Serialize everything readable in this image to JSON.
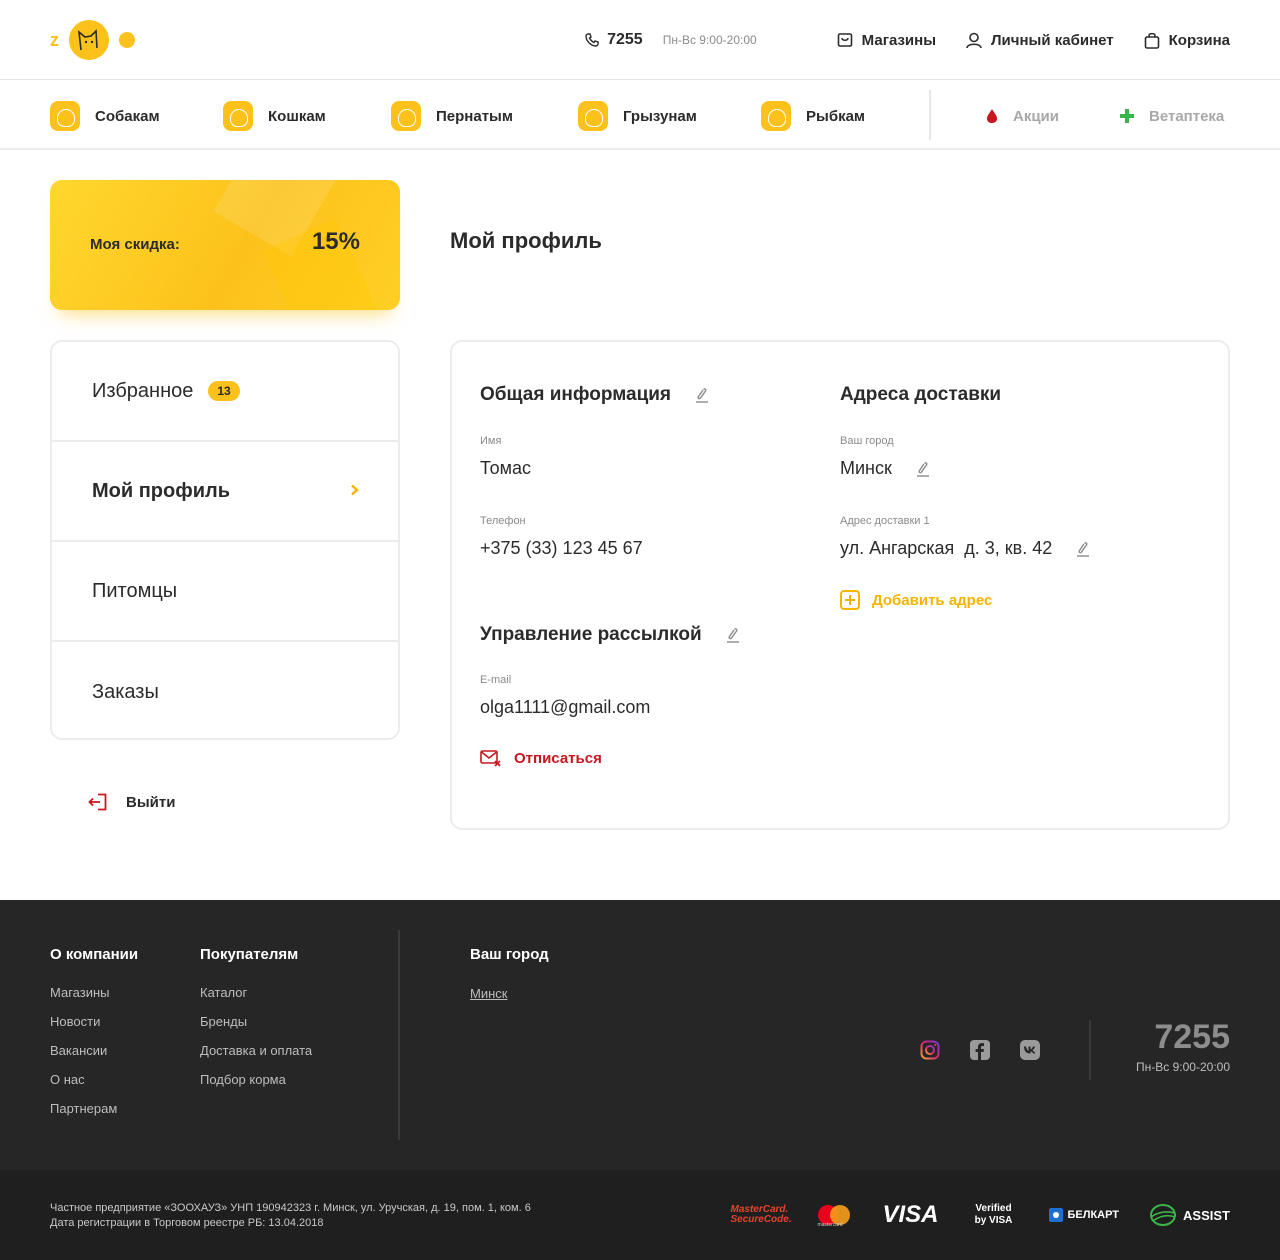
{
  "header": {
    "phone": "7255",
    "hours": "Пн-Вс 9:00-20:00",
    "links": [
      "Магазины",
      "Личный кабинет",
      "Корзина"
    ]
  },
  "nav": {
    "categories": [
      "Собакам",
      "Кошкам",
      "Пернатым",
      "Грызунам",
      "Рыбкам"
    ],
    "extra": [
      "Акции",
      "Ветаптека"
    ]
  },
  "discount": {
    "label": "Моя скидка:",
    "value": "15%"
  },
  "page_title": "Мой профиль",
  "side_menu": {
    "items": [
      {
        "label": "Избранное",
        "badge": "13"
      },
      {
        "label": "Мой профиль"
      },
      {
        "label": "Питомцы"
      },
      {
        "label": "Заказы"
      }
    ],
    "logout": "Выйти"
  },
  "profile": {
    "general": {
      "title": "Общая информация",
      "name_label": "Имя",
      "name": "Томас",
      "phone_label": "Телефон",
      "phone": "+375 (33) 123 45 67"
    },
    "mailing": {
      "title": "Управление рассылкой",
      "email_label": "E-mail",
      "email": "olga1111@gmail.com",
      "unsubscribe": "Отписаться"
    },
    "delivery": {
      "title": "Адреса доставки",
      "city_label": "Ваш город",
      "city": "Минск",
      "address_label": "Адрес доставки 1",
      "address": "ул. Ангарская  д. 3, кв. 42",
      "add_address": "Добавить адрес"
    }
  },
  "footer": {
    "company": {
      "title": "О компании",
      "links": [
        "Магазины",
        "Новости",
        "Вакансии",
        "О нас",
        "Партнерам"
      ]
    },
    "buyers": {
      "title": "Покупателям",
      "links": [
        "Каталог",
        "Бренды",
        "Доставка и оплата",
        "Подбор корма"
      ]
    },
    "city": {
      "title": "Ваш город",
      "value": "Минск"
    },
    "phone": "7255",
    "hours": "Пн-Вс 9:00-20:00",
    "legal_1": "Частное предприятие «ЗООХАУЗ» УНП 190942323 г. Минск, ул. Уручская, д. 19, пом. 1, ком. 6",
    "legal_2": "Дата регистрации в Торговом реестре РБ: 13.04.2018",
    "payments": [
      "MasterCard. SecureCode.",
      "mastercard",
      "VISA",
      "Verified by VISA",
      "БЕЛКАРТ",
      "ASSIST"
    ]
  },
  "colors": {
    "accent": "#fcc21b",
    "danger": "#c8171f",
    "footer_bg": "#262626",
    "footer_bottom": "#1f1f1f"
  }
}
